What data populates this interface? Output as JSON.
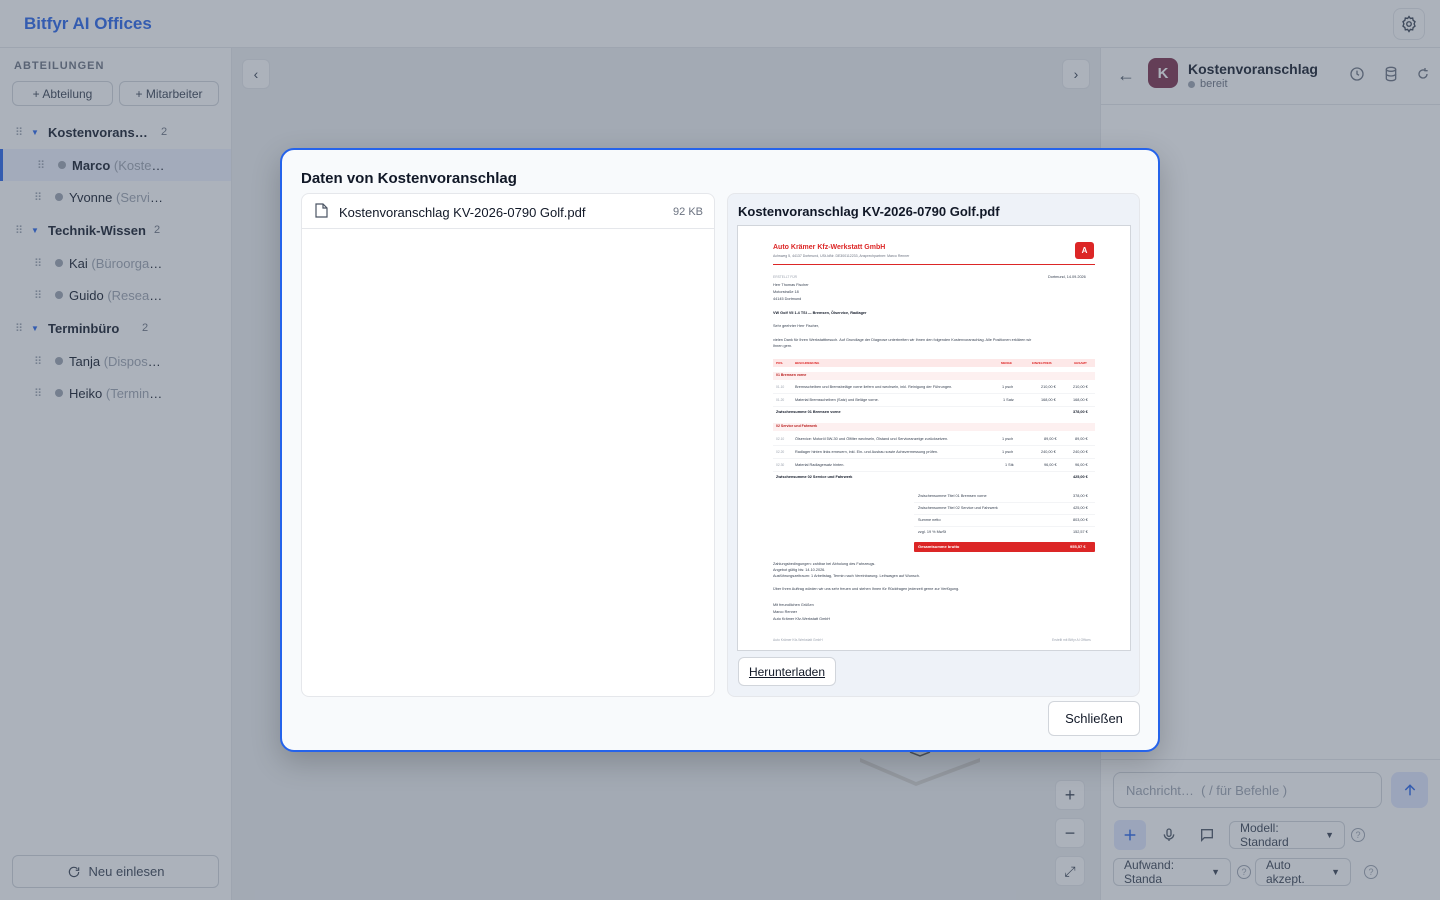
{
  "app": {
    "title": "Bitfyr AI Offices"
  },
  "sidebar": {
    "heading": "ABTEILUNGEN",
    "add_department": "+ Abteilung",
    "add_employee": "+ Mitarbeiter",
    "departments": [
      {
        "name": "Kostenvoranschlag",
        "count": "2",
        "employees": [
          {
            "name": "Marco",
            "role": "(Kostenvoranschlag)"
          },
          {
            "name": "Yvonne",
            "role": "(Service)"
          }
        ]
      },
      {
        "name": "Technik-Wissen",
        "count": "2",
        "employees": [
          {
            "name": "Kai",
            "role": "(Büroorganisation)"
          },
          {
            "name": "Guido",
            "role": "(Research)"
          }
        ]
      },
      {
        "name": "Terminbüro",
        "count": "2",
        "employees": [
          {
            "name": "Tanja",
            "role": "(Disposition)"
          },
          {
            "name": "Heiko",
            "role": "(Terminplanung)"
          }
        ]
      }
    ],
    "reload_label": "Neu einlesen"
  },
  "canvas": {
    "prev_label": "‹",
    "next_label": "›",
    "zoom_in": "+",
    "zoom_out": "−",
    "fit": "⤢"
  },
  "chat": {
    "avatar_letter": "K",
    "agent_name": "Kostenvoranschlag",
    "agent_status": "bereit",
    "input_placeholder": "Nachricht…  ( / für Befehle )",
    "model_select": "Modell: Standard",
    "effort_select": "Aufwand: Standa",
    "accept_select": "Auto akzept."
  },
  "modal": {
    "title": "Daten von Kostenvoranschlag",
    "files": [
      {
        "name": "Kostenvoranschlag KV-2026-0790 Golf.pdf",
        "size": "92 KB"
      }
    ],
    "preview_title": "Kostenvoranschlag KV-2026-0790 Golf.pdf",
    "download_label": "Herunterladen",
    "close_label": "Schließen"
  },
  "pdf": {
    "company": "Auto Krämer Kfz-Werkstatt GmbH",
    "address_line": "Achsweg 5, 44137 Dortmund, USt-IdNr. DE300112233, Ansprechpartner: Marco Renner",
    "logo_letter": "A",
    "prepared_for": "ERSTELLT FÜR",
    "place_date": "Dortmund, 14.09.2026",
    "recipient": [
      "Herr Thomas Fischer",
      "Motorstraße 18",
      "44145 Dortmund"
    ],
    "subject": "VW Golf VII 1.4 TSI — Bremsen, Ölservice, Radlager",
    "salutation": "Sehr geehrter Herr Fischer,",
    "intro": [
      "vielen Dank für Ihren Werkstattbesuch. Auf Grundlage der Diagnose unterbreiten wir Ihnen den folgenden Kostenvoranschlag. Alle Positionen erklären wir",
      "Ihnen gern."
    ],
    "table_headers": {
      "pos": "POS.",
      "desc": "BESCHREIBUNG",
      "qty": "MENGE",
      "unit": "EINZELPREIS",
      "total": "GESAMT"
    },
    "sections": [
      {
        "title": "01   Bremsen vorne",
        "rows": [
          {
            "pos": "01.10",
            "desc": "Bremsscheiben und Bremsbeläge vorne liefern und wechseln, inkl. Reinigung der Führungen.",
            "qty": "1 psch",
            "unit": "210,00 €",
            "total": "210,00 €"
          },
          {
            "pos": "01.20",
            "desc": "Material Bremsscheiben (Satz) und Beläge vorne.",
            "qty": "1 Satz",
            "unit": "168,00 €",
            "total": "168,00 €"
          }
        ],
        "subtotal_label": "Zwischensumme 01 Bremsen vorne",
        "subtotal": "378,00 €"
      },
      {
        "title": "02   Service und Fahrwerk",
        "rows": [
          {
            "pos": "02.10",
            "desc": "Ölservice: Motoröl 5W-30 und Ölfilter wechseln, Ölstand und Serviceanzeige zurücksetzen.",
            "qty": "1 psch",
            "unit": "89,00 €",
            "total": "89,00 €"
          },
          {
            "pos": "02.20",
            "desc": "Radlager hinten links erneuern, inkl. Ein- und Ausbau sowie Achsvermessung prüfen.",
            "qty": "1 psch",
            "unit": "240,00 €",
            "total": "240,00 €"
          },
          {
            "pos": "02.30",
            "desc": "Material Radlagersatz hinten.",
            "qty": "1 Stk",
            "unit": "96,00 €",
            "total": "96,00 €"
          }
        ],
        "subtotal_label": "Zwischensumme 02 Service und Fahrwerk",
        "subtotal": "425,00 €"
      }
    ],
    "summary": [
      {
        "label": "Zwischensumme Titel 01 Bremsen vorne",
        "value": "378,00 €"
      },
      {
        "label": "Zwischensumme Titel 02 Service und Fahrwerk",
        "value": "425,00 €"
      },
      {
        "label": "Summe netto",
        "value": "803,00 €"
      },
      {
        "label": "zzgl. 19 % MwSt",
        "value": "152,57 €"
      }
    ],
    "gross_label": "Gesamtsumme brutto",
    "gross_value": "955,57 €",
    "terms": [
      "Zahlungsbedingungen: zahlbar bei Abholung des Fahrzeugs.",
      "Angebot gültig bis: 14.10.2026.",
      "Ausführungszeitraum: 1 Arbeitstag, Termin nach Vereinbarung. Leihwagen auf Wunsch."
    ],
    "closing_note": "Über Ihren Auftrag würden wir uns sehr freuen und stehen Ihnen für Rückfragen jederzeit gerne zur Verfügung.",
    "signature": [
      "Mit freundlichen Grüßen",
      "Marco Renner",
      "Auto Krämer Kfz-Werkstatt GmbH"
    ],
    "footer_left": "Auto Krämer Kfz-Werkstatt GmbH",
    "footer_right": "Erstellt mit Bitfyr AI Offices"
  },
  "colors": {
    "accent": "#2563eb",
    "brand_red": "#dc2626",
    "avatar": "#7c2d4a"
  }
}
